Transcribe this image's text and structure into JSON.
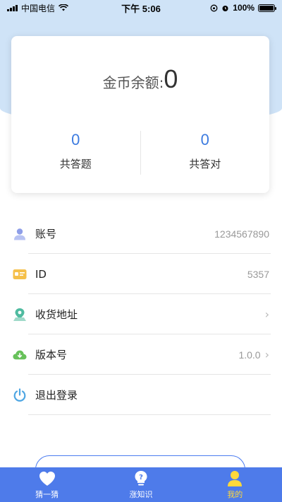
{
  "status_bar": {
    "carrier": "中国电信",
    "time": "下午 5:06",
    "battery": "100%"
  },
  "card": {
    "balance_label": "金币余额:",
    "balance_value": "0",
    "stats": [
      {
        "value": "0",
        "label": "共答题"
      },
      {
        "value": "0",
        "label": "共答对"
      }
    ]
  },
  "menu": [
    {
      "label": "账号",
      "value": "1234567890",
      "icon": "user-icon",
      "chevron": false
    },
    {
      "label": "ID",
      "value": "5357",
      "icon": "id-card-icon",
      "chevron": false
    },
    {
      "label": "收货地址",
      "value": "",
      "icon": "location-icon",
      "chevron": true
    },
    {
      "label": "版本号",
      "value": "1.0.0",
      "icon": "cloud-download-icon",
      "chevron": true
    },
    {
      "label": "退出登录",
      "value": "",
      "icon": "power-icon",
      "chevron": false
    }
  ],
  "tabs": [
    {
      "label": "猜一猜",
      "icon": "heart-icon"
    },
    {
      "label": "涨知识",
      "icon": "lightbulb-icon"
    },
    {
      "label": "我的",
      "icon": "person-icon"
    }
  ],
  "colors": {
    "accent": "#4e7bea",
    "active_tab": "#ffd83a",
    "stat_value": "#3c7be0",
    "header_bg": "#cfe3f7"
  }
}
